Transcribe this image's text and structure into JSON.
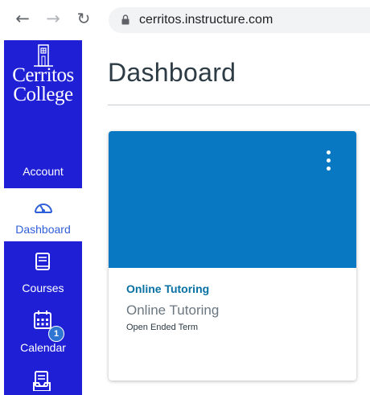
{
  "browser": {
    "url": "cerritos.instructure.com"
  },
  "sidebar": {
    "logo_line1": "Cerritos",
    "logo_line2": "College",
    "items": [
      {
        "label": "Account",
        "icon": "user-avatar-icon"
      },
      {
        "label": "Dashboard",
        "icon": "speedometer-icon",
        "active": true
      },
      {
        "label": "Courses",
        "icon": "book-icon"
      },
      {
        "label": "Calendar",
        "icon": "calendar-icon"
      },
      {
        "label": "",
        "icon": "inbox-icon",
        "badge": "1"
      }
    ],
    "color": "#1f1fd6"
  },
  "main": {
    "title": "Dashboard",
    "card": {
      "link_title": "Online Tutoring",
      "subtitle": "Online Tutoring",
      "term": "Open Ended Term",
      "hero_color": "#0778c1"
    }
  }
}
